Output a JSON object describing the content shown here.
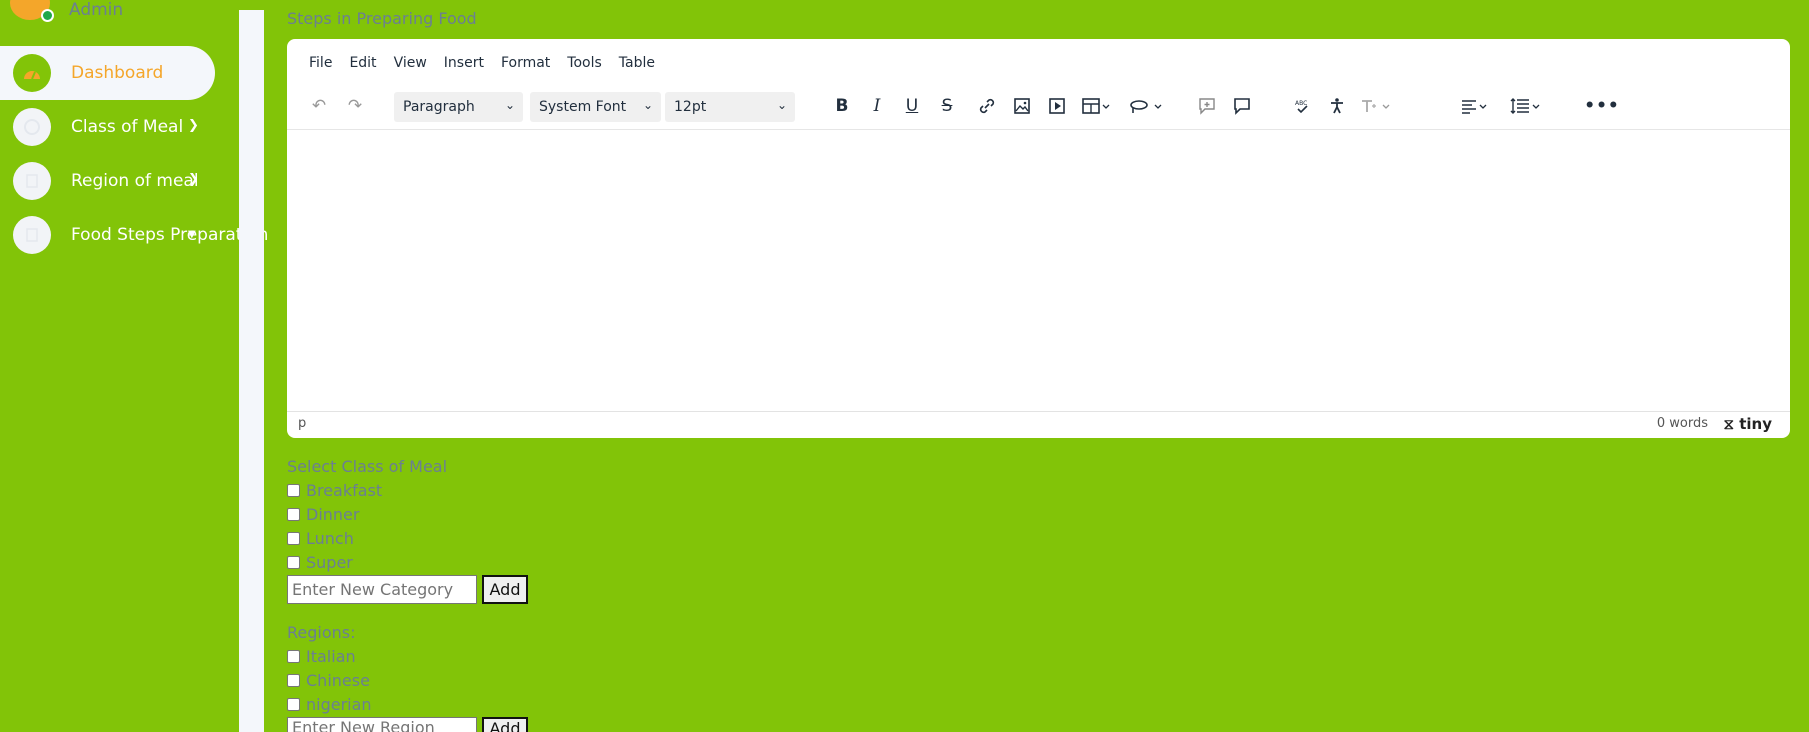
{
  "sidebar": {
    "admin_name": "Admin",
    "items": [
      {
        "label": "Dashboard",
        "icon": "dashboard-icon"
      },
      {
        "label": "Class of Meal",
        "icon": "meal-icon"
      },
      {
        "label": "Region of meal",
        "icon": "region-icon"
      },
      {
        "label": "Food Steps Preparation",
        "icon": "steps-icon"
      }
    ]
  },
  "editor": {
    "label": "Steps in Preparing Food",
    "menu": [
      "File",
      "Edit",
      "View",
      "Insert",
      "Format",
      "Tools",
      "Table"
    ],
    "block_format": "Paragraph",
    "font_family": "System Font",
    "font_size": "12pt",
    "status_element": "p",
    "word_count": "0 words",
    "brand": "tiny"
  },
  "meal_classes": {
    "label": "Select Class of Meal",
    "options": [
      "Breakfast",
      "Dinner",
      "Lunch",
      "Super"
    ],
    "input_placeholder": "Enter New Category",
    "add_label": "Add"
  },
  "regions": {
    "label": "Regions:",
    "options": [
      "Italian",
      "Chinese",
      "nigerian"
    ],
    "input_placeholder": "Enter New Region",
    "add_label": "Add"
  },
  "colors": {
    "background": "#82c408",
    "accent": "#f4a62a",
    "text_muted": "#6b7f93"
  }
}
